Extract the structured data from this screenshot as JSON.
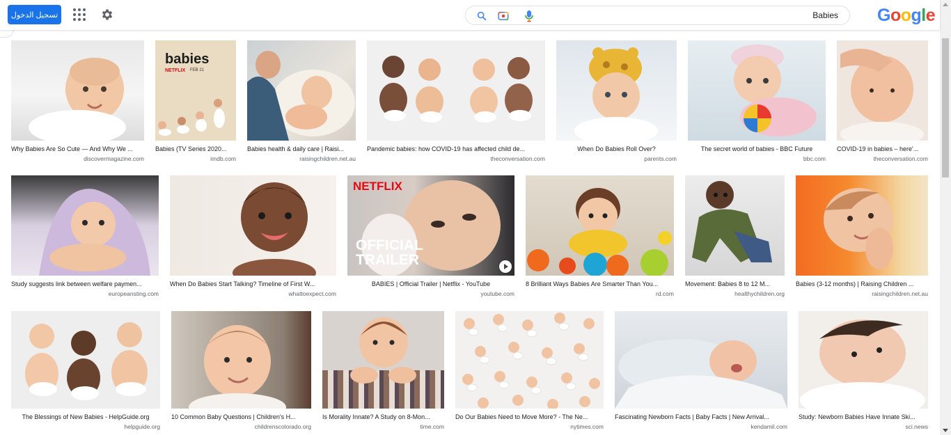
{
  "header": {
    "signin_label": "تسجيل الدخول",
    "search_query": "Babies",
    "logo_letters": [
      "G",
      "o",
      "o",
      "g",
      "l",
      "e"
    ]
  },
  "icons": {
    "apps": "apps-grid-icon",
    "settings": "gear-icon",
    "search": "search-icon",
    "camera": "camera-icon",
    "mic": "microphone-icon"
  },
  "results": [
    {
      "caption": "Why Babies Are So Cute — And Why We ...",
      "source": "discovermagazine.com"
    },
    {
      "caption": "Babies (TV Series 2020...",
      "source": "imdb.com",
      "poster_title": "babies",
      "poster_brand": "NETFLIX",
      "poster_date": "FEB 21"
    },
    {
      "caption": "Babies health & daily care | Raisi...",
      "source": "raisingchildren.net.au"
    },
    {
      "caption": "Pandemic babies: how COVID-19 has affected child de...",
      "source": "theconversation.com"
    },
    {
      "caption": "When Do Babies Roll Over?",
      "source": "parents.com"
    },
    {
      "caption": "The secret world of babies - BBC Future",
      "source": "bbc.com"
    },
    {
      "caption": "COVID-19 in babies – here'...",
      "source": "theconversation.com"
    },
    {
      "caption": "Study suggests link between welfare paymen...",
      "source": "europeansting.com"
    },
    {
      "caption": "When Do Babies Start Talking? Timeline of First W...",
      "source": "whattoexpect.com"
    },
    {
      "caption": "BABIES | Official Trailer | Netflix - YouTube",
      "source": "youtube.com",
      "overlay_brand": "NETFLIX",
      "overlay_line1": "OFFICIAL",
      "overlay_line2": "TRAILER"
    },
    {
      "caption": "8 Brilliant Ways Babies Are Smarter Than You...",
      "source": "rd.com"
    },
    {
      "caption": "Movement: Babies 8 to 12 M...",
      "source": "healthychildren.org"
    },
    {
      "caption": "Babies (3-12 months) | Raising Children ...",
      "source": "raisingchildren.net.au"
    },
    {
      "caption": "The Blessings of New Babies - HelpGuide.org",
      "source": "helpguide.org"
    },
    {
      "caption": "10 Common Baby Questions | Children's H...",
      "source": "childrenscolorado.org"
    },
    {
      "caption": "Is Morality Innate? A Study on 8-Mon...",
      "source": "time.com"
    },
    {
      "caption": "Do Our Babies Need to Move More? - The Ne...",
      "source": "nytimes.com"
    },
    {
      "caption": "Fascinating Newborn Facts | Baby Facts | New Arrival...",
      "source": "kendamil.com"
    },
    {
      "caption": "Study: Newborn Babies Have Innate Ski...",
      "source": "sci.news"
    }
  ],
  "colors": {
    "accent": "#1a73e8",
    "skin": "#f2c9a8",
    "netflix_red": "#e50914"
  }
}
